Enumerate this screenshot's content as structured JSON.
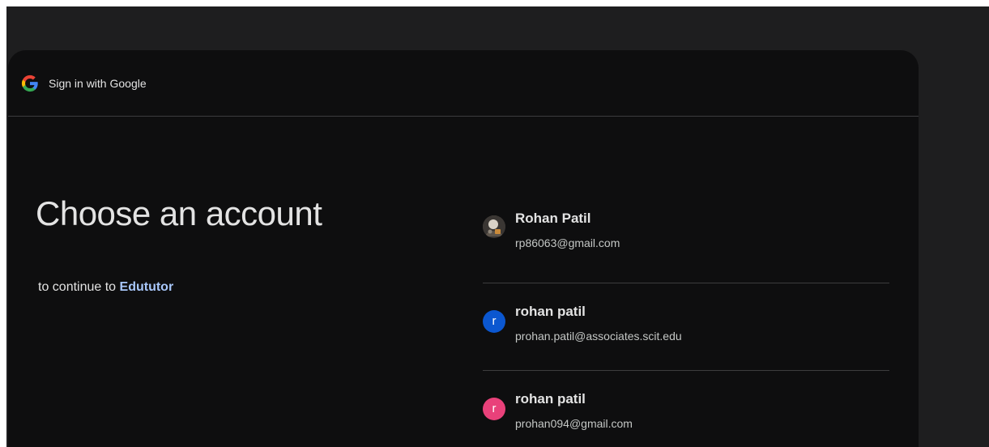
{
  "header": {
    "title": "Sign in with Google",
    "logo_icon": "google-g-icon"
  },
  "main": {
    "heading": "Choose an account",
    "subtext_prefix": "to continue to",
    "app_name": "Edututor"
  },
  "accounts": [
    {
      "name": "Rohan Patil",
      "email": "rp86063@gmail.com",
      "avatar_type": "photo"
    },
    {
      "name": "rohan patil",
      "email": "prohan.patil@associates.scit.edu",
      "avatar_letter": "r",
      "avatar_color": "#0b57d0"
    },
    {
      "name": "rohan patil",
      "email": "prohan094@gmail.com",
      "avatar_letter": "r",
      "avatar_color": "#e9417a"
    }
  ],
  "colors": {
    "background": "#1e1e1f",
    "card": "#0e0e0f",
    "text": "#e3e3e3",
    "link": "#a8c7fa"
  }
}
